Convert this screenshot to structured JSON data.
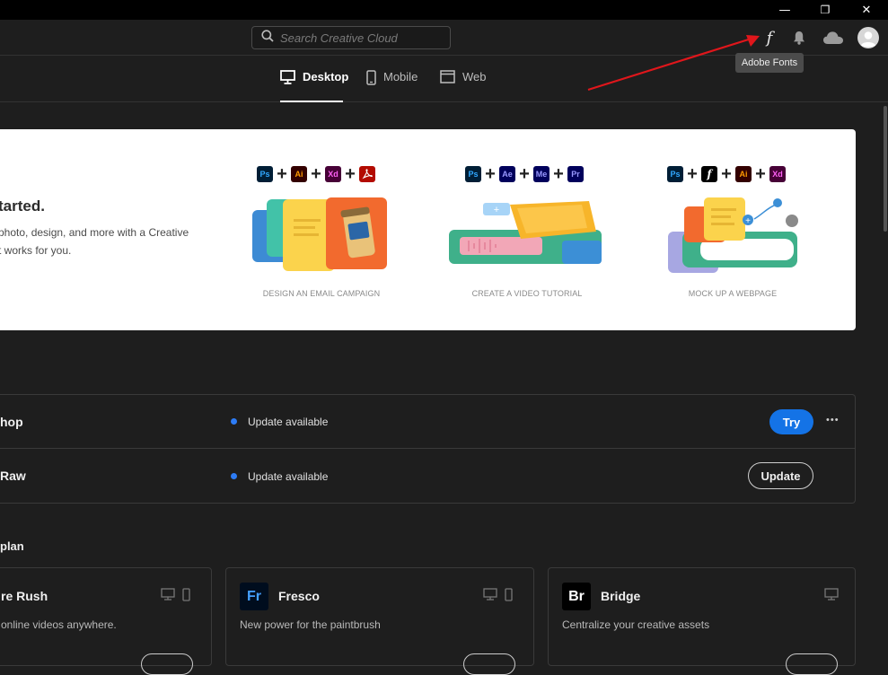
{
  "window": {
    "minimize": "—",
    "restore": "❐",
    "close": "✕"
  },
  "header": {
    "search_placeholder": "Search Creative Cloud",
    "icons": [
      "fonts-icon",
      "bell-icon",
      "cloud-icon",
      "avatar-icon"
    ],
    "fonts_glyph": "f",
    "tooltip": "Adobe Fonts"
  },
  "tabs": [
    {
      "label": "Desktop",
      "icon": "monitor-icon",
      "active": true
    },
    {
      "label": "Mobile",
      "icon": "phone-icon",
      "active": false
    },
    {
      "label": "Web",
      "icon": "browser-icon",
      "active": false
    }
  ],
  "hero": {
    "title": "tarted.",
    "desc_line1": "photo, design, and more with a Creative",
    "desc_line2": "t works for you.",
    "projects": [
      {
        "caption": "DESIGN AN EMAIL CAMPAIGN",
        "apps": [
          "Ps",
          "Ai",
          "Xd",
          "Acrobat"
        ]
      },
      {
        "caption": "CREATE A VIDEO TUTORIAL",
        "apps": [
          "Ps",
          "Ae",
          "Me",
          "Pr"
        ]
      },
      {
        "caption": "MOCK UP A WEBPAGE",
        "apps": [
          "Ps",
          "f",
          "Ai",
          "Xd"
        ]
      }
    ]
  },
  "apps": [
    {
      "name": "hop",
      "status": "Update available",
      "button": "Try",
      "more": "•••"
    },
    {
      "name": "Raw",
      "status": "Update available",
      "button": "Update"
    }
  ],
  "plan": {
    "title": "plan",
    "cards": [
      {
        "name": "re Rush",
        "desc": "online videos anywhere."
      },
      {
        "name": "Fresco",
        "logo": "Fr",
        "desc": "New power for the paintbrush"
      },
      {
        "name": "Bridge",
        "logo": "Br",
        "desc": "Centralize your creative assets"
      }
    ]
  },
  "colors": {
    "accent": "#1473e6",
    "background": "#1e1e1e",
    "annotation_arrow": "#e0161b"
  }
}
